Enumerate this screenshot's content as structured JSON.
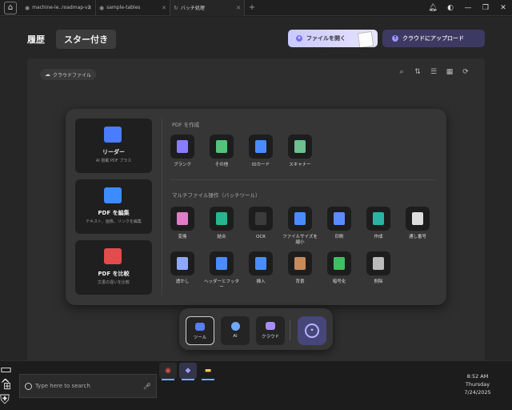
{
  "tabs": [
    {
      "label": "machine-le..roadmap-v2",
      "icon": "github-icon"
    },
    {
      "label": "sample-tables",
      "icon": "github-icon"
    },
    {
      "label": "バッチ処理",
      "icon": "batch-icon"
    }
  ],
  "header": {
    "history": "履歴",
    "starred": "スター付き",
    "open_file": "ファイルを開く",
    "upload_cloud": "クラウドにアップロード"
  },
  "panel": {
    "cloud_file": "クラウドファイル"
  },
  "left_tiles": [
    {
      "title": "リーダー",
      "subtitle": "AI 搭載 PDF プラス",
      "color": "#4a7cff"
    },
    {
      "title": "PDF を編集",
      "subtitle": "テキスト、画像、リンクを編集",
      "color": "#3d8cff"
    },
    {
      "title": "PDF を比較",
      "subtitle": "文書の違いを比較",
      "color": "#e24c4c"
    }
  ],
  "create_section": {
    "label": "PDF を作成",
    "tools": [
      {
        "label": "ブランク",
        "color": "#8a7cff"
      },
      {
        "label": "その他",
        "color": "#56c27a"
      },
      {
        "label": "IDカード",
        "color": "#4a8cff"
      },
      {
        "label": "スキャナー",
        "color": "#6fbf8f"
      }
    ]
  },
  "multi_section": {
    "label": "マルチファイル操作（バッチツール）",
    "row1": [
      {
        "label": "変換",
        "color": "#e27cc9"
      },
      {
        "label": "結合",
        "color": "#27b58f"
      },
      {
        "label": "OCR",
        "color": "#3b3b3b"
      },
      {
        "label": "ファイルサイズを縮小",
        "color": "#4a8cff"
      },
      {
        "label": "印刷",
        "color": "#5a8cff"
      },
      {
        "label": "作成",
        "color": "#2bb3a6"
      },
      {
        "label": "通し番号",
        "color": "#dddddd"
      }
    ],
    "row2": [
      {
        "label": "透かし",
        "color": "#8fa8ff"
      },
      {
        "label": "ヘッダーとフッター",
        "color": "#4a8cff"
      },
      {
        "label": "挿入",
        "color": "#4a8cff"
      },
      {
        "label": "背景",
        "color": "#c98a5a"
      },
      {
        "label": "暗号化",
        "color": "#3fbf63"
      },
      {
        "label": "削除",
        "color": "#bbbbbb"
      }
    ]
  },
  "dock": [
    {
      "label": "ツール",
      "color": "#5a7cff"
    },
    {
      "label": "AI",
      "color": "#6fa8ff"
    },
    {
      "label": "クラウド",
      "color": "#a88cff"
    }
  ],
  "taskbar": {
    "search_placeholder": "Type here to search",
    "time": "8:52 AM",
    "day": "Thursday",
    "date": "7/24/2025"
  }
}
